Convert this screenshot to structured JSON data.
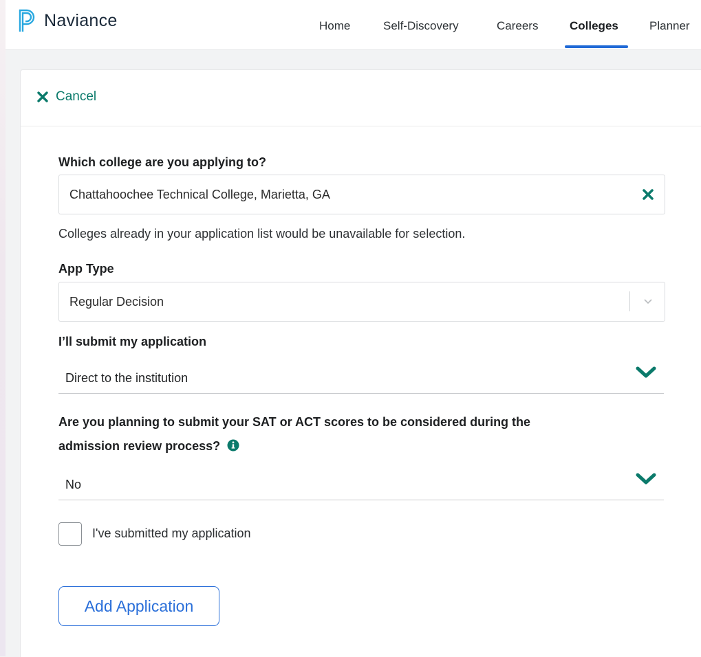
{
  "brand": {
    "name": "Naviance"
  },
  "nav": {
    "items": [
      {
        "label": "Home"
      },
      {
        "label": "Self-Discovery"
      },
      {
        "label": "Careers"
      },
      {
        "label": "Colleges",
        "active": true
      },
      {
        "label": "Planner"
      }
    ]
  },
  "cancel": {
    "label": "Cancel",
    "icon": "close-icon"
  },
  "form": {
    "college": {
      "label": "Which college are you applying to?",
      "value": "Chattahoochee Technical College, Marietta, GA",
      "clear_icon": "close-icon",
      "helper": "Colleges already in your application list would be unavailable for selection."
    },
    "app_type": {
      "label": "App Type",
      "value": "Regular Decision",
      "icon": "chevron-down-icon"
    },
    "submit_via": {
      "label": "I’ll submit my application",
      "value": "Direct to the institution",
      "icon": "chevron-down-icon"
    },
    "test_scores": {
      "label_line1": "Are you planning to submit your SAT or ACT scores to be considered during the",
      "label_line2": "admission review process?",
      "info_icon": "info-icon",
      "value": "No",
      "icon": "chevron-down-icon"
    },
    "submitted": {
      "label": "I've submitted my application",
      "checked": false
    },
    "add_button": {
      "label": "Add Application"
    }
  },
  "colors": {
    "accent_teal": "#0b7a6b",
    "primary_blue": "#2a6fd9",
    "nav_underline": "#1f69d6"
  }
}
